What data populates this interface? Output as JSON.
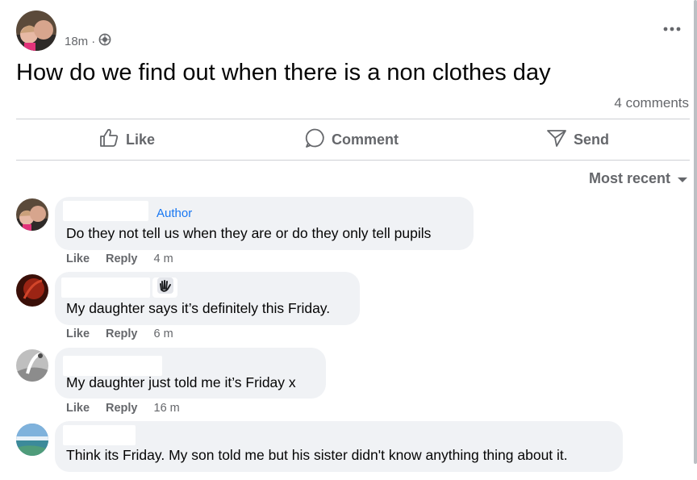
{
  "post": {
    "time": "18m",
    "separator": "·",
    "audience_icon": "globe-icon",
    "more_icon": "ellipsis-icon",
    "text": "How do we find out when there is a non clothes day",
    "comments_count": "4 comments"
  },
  "actions": {
    "like": "Like",
    "comment": "Comment",
    "send": "Send"
  },
  "sort": {
    "label": "Most recent",
    "icon": "caret-down-icon"
  },
  "comments": [
    {
      "badge": "Author",
      "text": "Do they not tell us when they are or do they only tell pupils",
      "like": "Like",
      "reply": "Reply",
      "time": "4 m"
    },
    {
      "badge_icon": "waving-hand-icon",
      "text": "My daughter says it’s definitely this Friday.",
      "like": "Like",
      "reply": "Reply",
      "time": "6 m"
    },
    {
      "text": "My daughter just told me it’s Friday x",
      "like": "Like",
      "reply": "Reply",
      "time": "16 m"
    },
    {
      "text": "Think its Friday. My son told me but his sister didn't know anything thing about it."
    }
  ],
  "colors": {
    "secondary_text": "#65676b",
    "bubble": "#f0f2f5",
    "author_badge": "#1877f2",
    "divider": "#ced0d4"
  }
}
